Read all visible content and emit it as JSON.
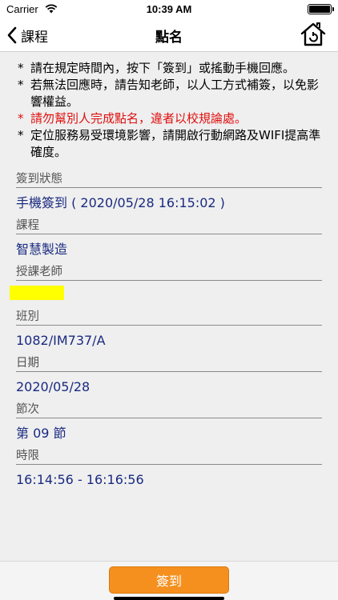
{
  "status_bar": {
    "carrier": "Carrier",
    "time": "10:39 AM"
  },
  "nav": {
    "back_label": "課程",
    "title": "點名"
  },
  "notes": [
    {
      "text": "請在規定時間內，按下「簽到」或搖動手機回應。",
      "color": "#000000"
    },
    {
      "text": "若無法回應時，請告知老師，以人工方式補簽，以免影響權益。",
      "color": "#000000"
    },
    {
      "text": "請勿幫別人完成點名，違者以校規論處。",
      "color": "#e01010"
    },
    {
      "text": "定位服務易受環境影響，請開啟行動網路及WIFI提高準確度。",
      "color": "#000000"
    }
  ],
  "fields": {
    "status": {
      "label": "簽到狀態",
      "value": "手機簽到 ( 2020/05/28 16:15:02 )"
    },
    "course": {
      "label": "課程",
      "value": "智慧製造"
    },
    "teacher": {
      "label": "授課老師",
      "value": ""
    },
    "class": {
      "label": "班別",
      "value": "1082/IM737/A"
    },
    "date": {
      "label": "日期",
      "value": "2020/05/28"
    },
    "period": {
      "label": "節次",
      "value": "第 09 節"
    },
    "time_limit": {
      "label": "時限",
      "value": "16:14:56 - 16:16:56"
    }
  },
  "bottom": {
    "signin_label": "簽到"
  },
  "colors": {
    "accent_button": "#f5901e",
    "value_text": "#1a2a80",
    "warning_text": "#e01010"
  }
}
